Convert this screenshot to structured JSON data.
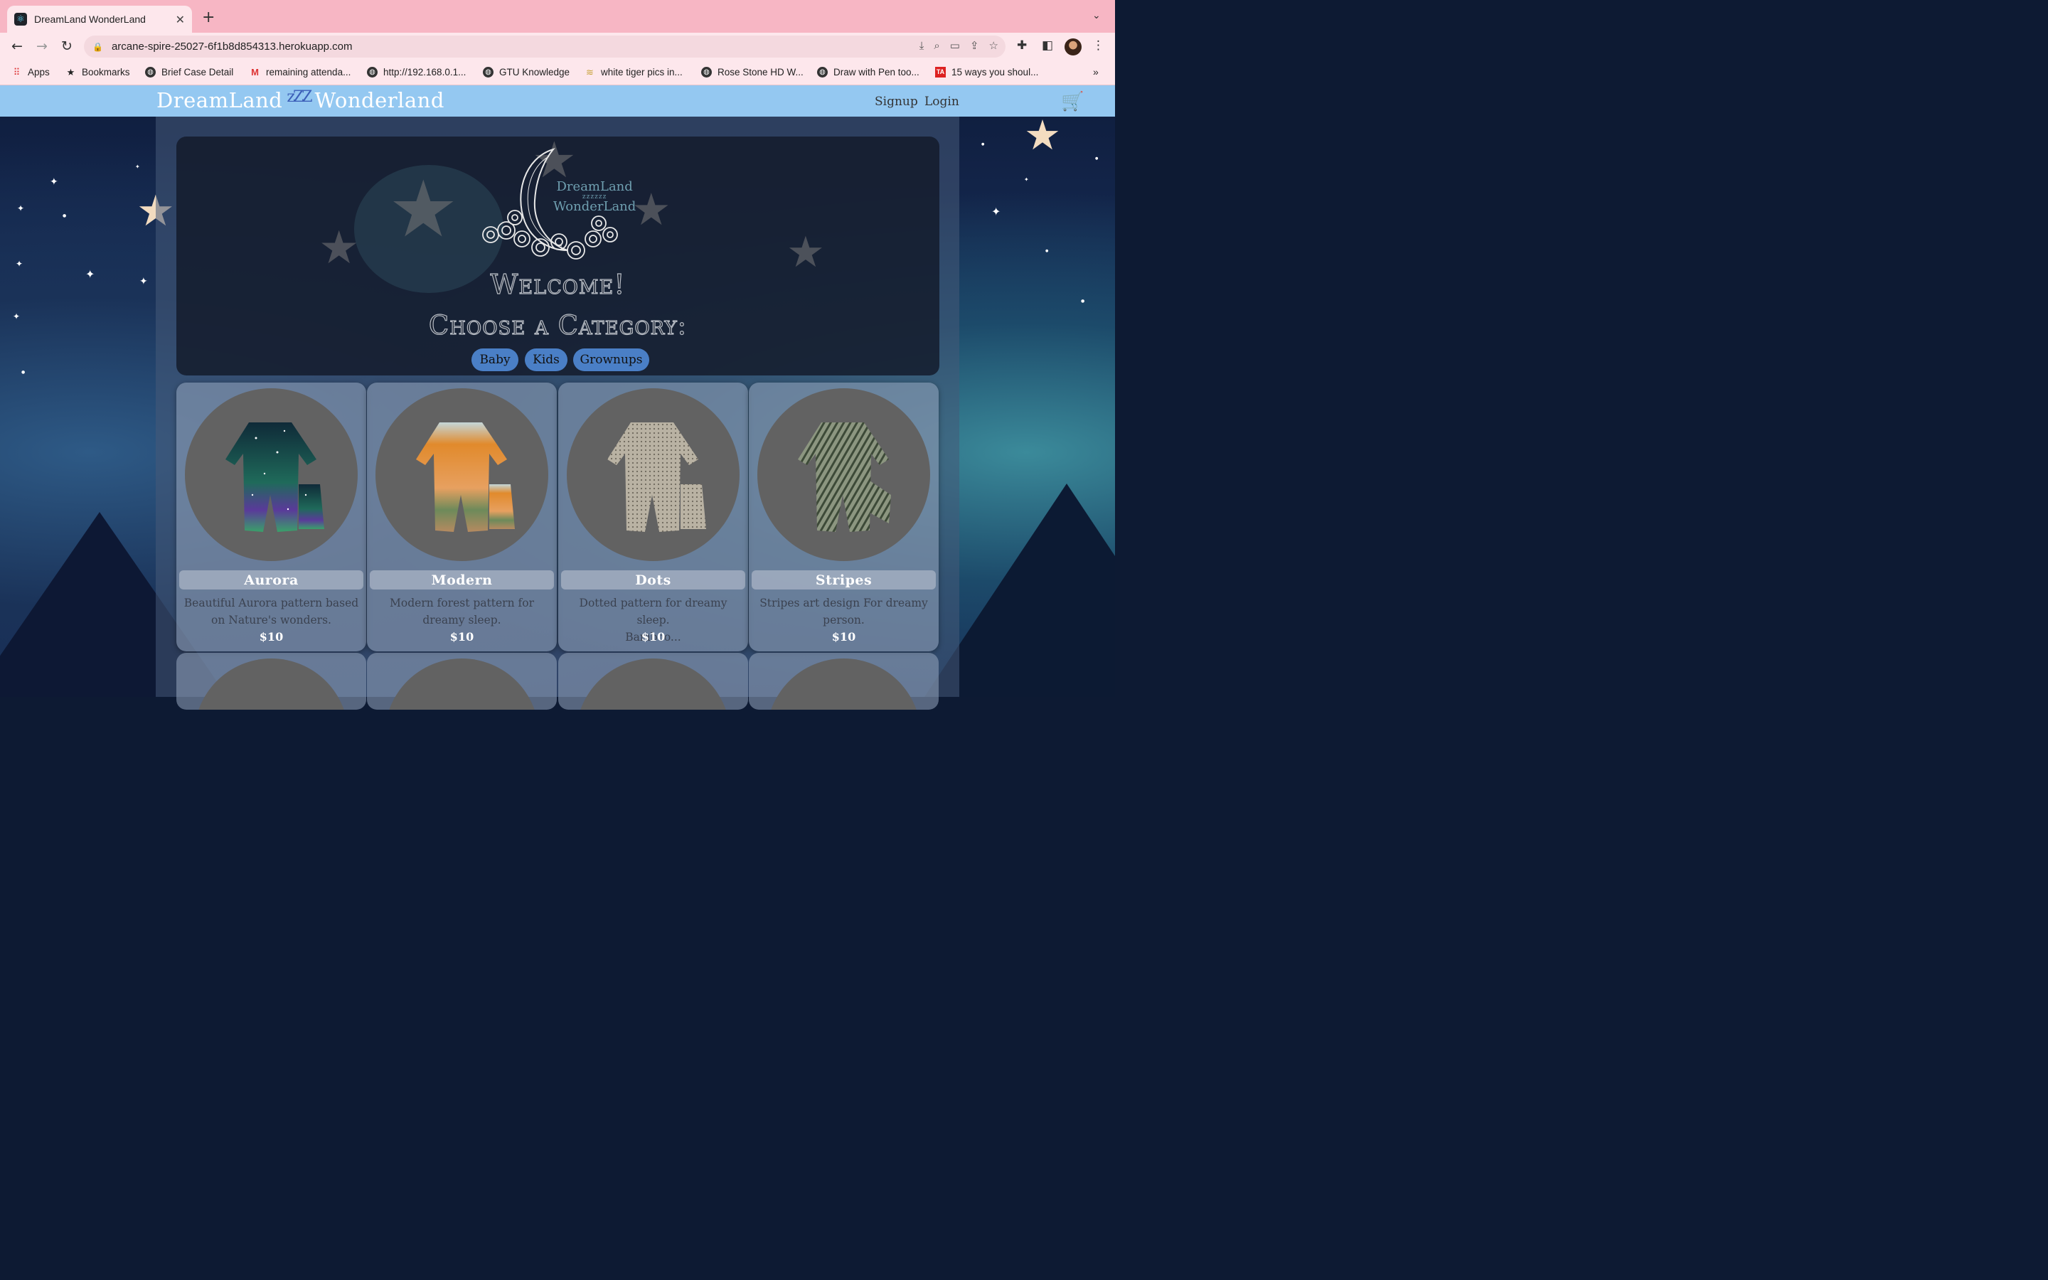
{
  "browser": {
    "tab_title": "DreamLand WonderLand",
    "url": "arcane-spire-25027-6f1b8d854313.herokuapp.com",
    "bookmarks": [
      {
        "label": "Apps",
        "icon": "apps-grid-icon"
      },
      {
        "label": "Bookmarks",
        "icon": "star-icon"
      },
      {
        "label": "Brief Case Detail",
        "icon": "globe-icon"
      },
      {
        "label": "remaining attenda...",
        "icon": "gmail-icon"
      },
      {
        "label": "http://192.168.0.1...",
        "icon": "globe-icon"
      },
      {
        "label": "GTU Knowledge",
        "icon": "globe-icon"
      },
      {
        "label": "white tiger pics in...",
        "icon": "stack-icon"
      },
      {
        "label": "Rose Stone HD W...",
        "icon": "globe-icon"
      },
      {
        "label": "Draw with Pen too...",
        "icon": "globe-icon"
      },
      {
        "label": "15 ways you shoul...",
        "icon": "ta-icon"
      }
    ]
  },
  "site": {
    "brand_left": "DreamLand",
    "brand_zzz": "zZZ",
    "brand_right": "Wonderland",
    "nav": {
      "signup": "Signup",
      "login": "Login"
    },
    "hero": {
      "logo_line1": "DreamLand",
      "logo_line2": "zzzzzz",
      "logo_line3": "WonderLand",
      "welcome": "Welcome!",
      "subtitle": "Choose a Category:",
      "categories": [
        "Baby",
        "Kids",
        "Grownups"
      ]
    },
    "products": [
      {
        "name": "Aurora",
        "desc_line1": "Beautiful Aurora pattern based",
        "desc_line2": "on Nature's wonders.",
        "price": "$10"
      },
      {
        "name": "Modern",
        "desc_line1": "Modern forest pattern for",
        "desc_line2": "dreamy sleep.",
        "price": "$10"
      },
      {
        "name": "Dots",
        "desc_line1": "Dotted pattern for dreamy sleep.",
        "desc_line2": "Bamboo...",
        "price": "$10"
      },
      {
        "name": "Stripes",
        "desc_line1": "Stripes art design For dreamy",
        "desc_line2": "person.",
        "price": "$10"
      }
    ]
  }
}
